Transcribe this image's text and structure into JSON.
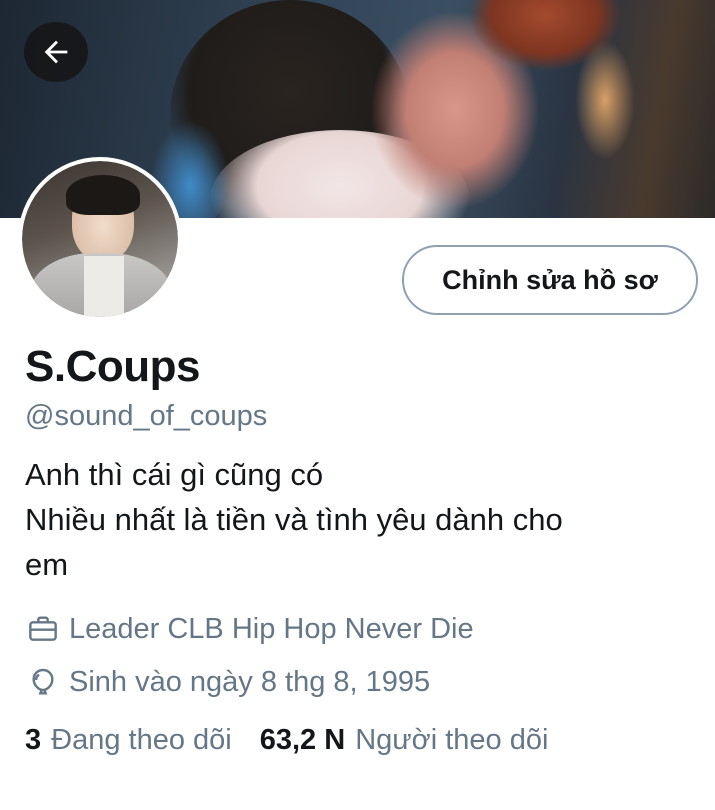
{
  "header": {
    "back_icon": "arrow-left-icon"
  },
  "profile": {
    "edit_button_label": "Chỉnh sửa hồ sơ",
    "name": "S.Coups",
    "handle": "@sound_of_coups",
    "bio_lines": [
      "Anh thì cái gì cũng có",
      "Nhiều nhất là tiền và tình yêu dành cho",
      "em"
    ],
    "occupation": {
      "icon": "briefcase-icon",
      "text": "Leader CLB Hip Hop Never Die"
    },
    "birthday": {
      "icon": "balloon-icon",
      "text": "Sinh vào ngày 8 thg 8, 1995"
    }
  },
  "stats": {
    "following_count": "3",
    "following_label": "Đang theo dõi",
    "followers_count": "63,2 N",
    "followers_label": "Người theo dõi"
  },
  "colors": {
    "text": "#14171a",
    "secondary": "#657786",
    "button_border": "#8fa1b0"
  }
}
